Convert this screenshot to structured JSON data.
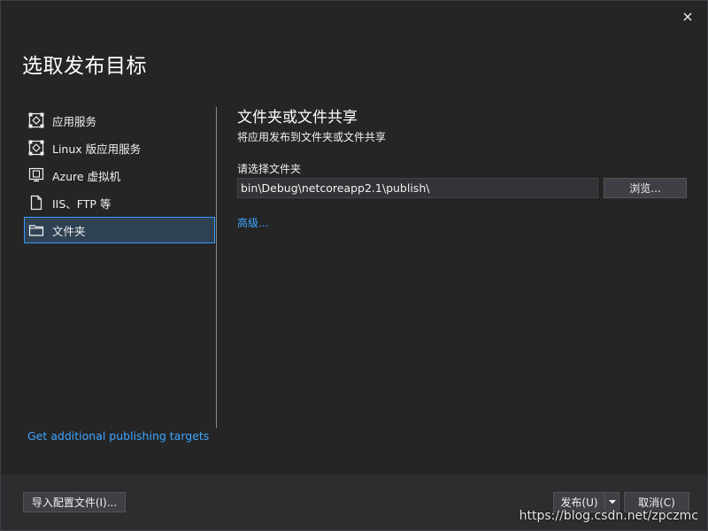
{
  "dialog": {
    "title": "选取发布目标",
    "close_icon": "close-icon"
  },
  "sidebar": {
    "items": [
      {
        "label": "应用服务",
        "icon": "app-service-icon",
        "selected": false
      },
      {
        "label": "Linux 版应用服务",
        "icon": "app-service-linux-icon",
        "selected": false
      },
      {
        "label": "Azure 虚拟机",
        "icon": "virtual-machine-icon",
        "selected": false
      },
      {
        "label": "IIS、FTP 等",
        "icon": "document-icon",
        "selected": false
      },
      {
        "label": "文件夹",
        "icon": "folder-icon",
        "selected": true
      }
    ],
    "more_link": "Get additional publishing targets"
  },
  "main": {
    "title": "文件夹或文件共享",
    "description": "将应用发布到文件夹或文件共享",
    "folder_label": "请选择文件夹",
    "folder_value": "bin\\Debug\\netcoreapp2.1\\publish\\",
    "browse_label": "浏览...",
    "advanced_link": "高级..."
  },
  "footer": {
    "import_label": "导入配置文件(I)...",
    "publish_label": "发布(U)",
    "cancel_label": "取消(C)"
  },
  "watermark": "https://blog.csdn.net/zpczmc",
  "colors": {
    "accent": "#3399ff",
    "link": "#3ea6ff",
    "background": "#252526"
  }
}
